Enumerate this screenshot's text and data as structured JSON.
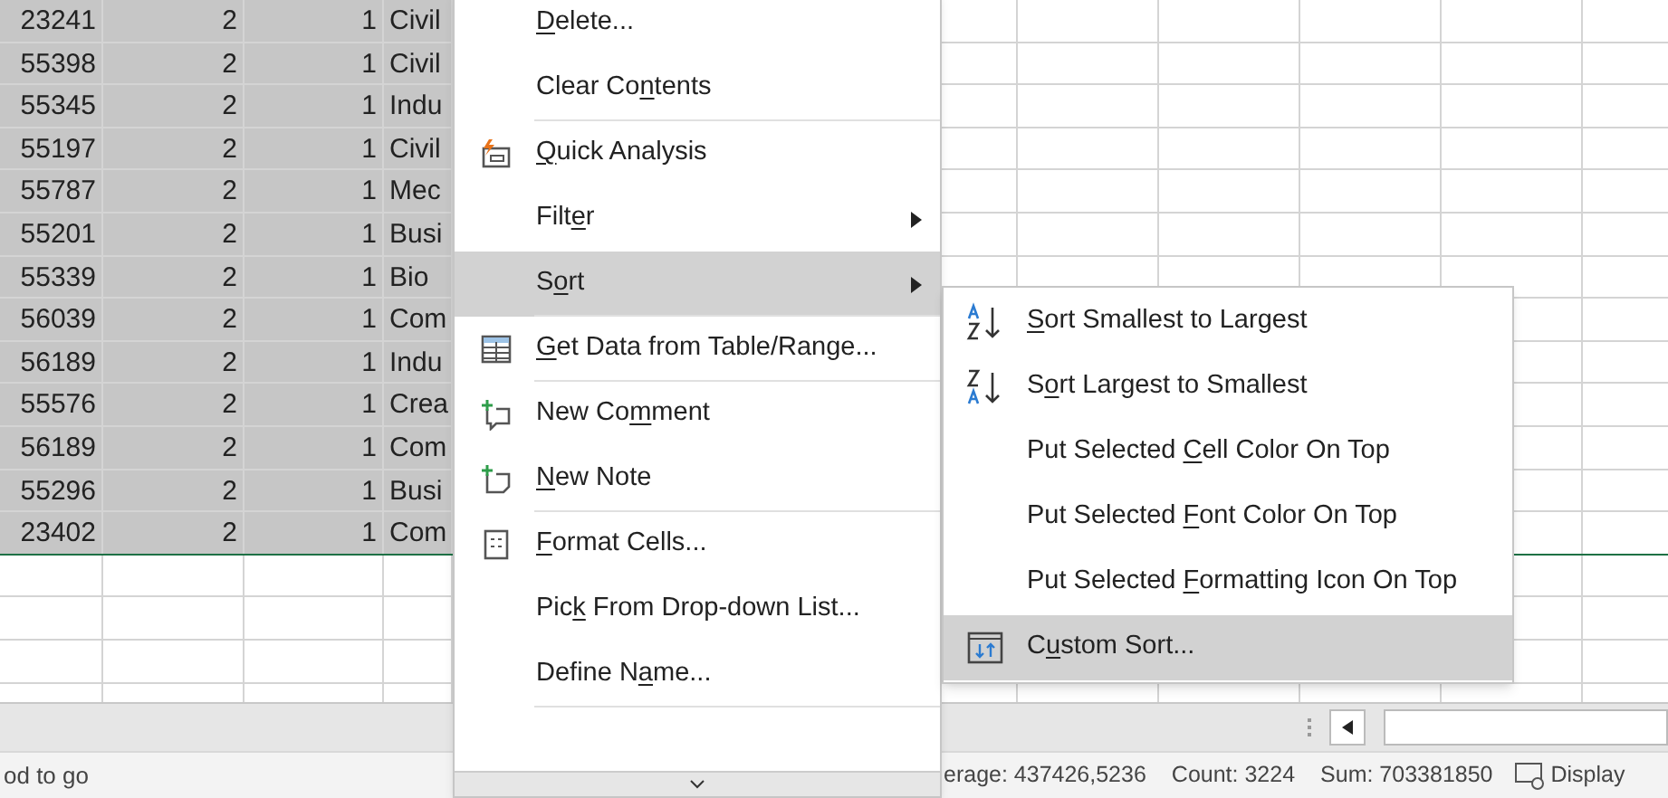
{
  "sheet": {
    "rows": [
      {
        "cells": [
          "23241",
          "2",
          "1",
          "Civil"
        ]
      },
      {
        "cells": [
          "55398",
          "2",
          "1",
          "Civil"
        ]
      },
      {
        "cells": [
          "55345",
          "2",
          "1",
          "Indu"
        ]
      },
      {
        "cells": [
          "55197",
          "2",
          "1",
          "Civil"
        ]
      },
      {
        "cells": [
          "55787",
          "2",
          "1",
          "Mec"
        ]
      },
      {
        "cells": [
          "55201",
          "2",
          "1",
          "Busi"
        ]
      },
      {
        "cells": [
          "55339",
          "2",
          "1",
          "Bio"
        ]
      },
      {
        "cells": [
          "56039",
          "2",
          "1",
          "Com"
        ]
      },
      {
        "cells": [
          "56189",
          "2",
          "1",
          "Indu"
        ]
      },
      {
        "cells": [
          "55576",
          "2",
          "1",
          "Crea"
        ]
      },
      {
        "cells": [
          "56189",
          "2",
          "1",
          "Com"
        ]
      },
      {
        "cells": [
          "55296",
          "2",
          "1",
          "Busi"
        ]
      },
      {
        "cells": [
          "23402",
          "2",
          "1",
          "Com"
        ]
      }
    ],
    "selected": true
  },
  "context_menu": {
    "items": [
      {
        "label": {
          "key": "D",
          "post": "elete..."
        },
        "selected": false,
        "submenu_arrow": false,
        "divider_after": false
      },
      {
        "label": {
          "pre": "Clear Co",
          "key": "n",
          "post": "tents"
        },
        "selected": false,
        "submenu_arrow": false,
        "divider_after": true
      },
      {
        "label": {
          "key": "Q",
          "post": "uick Analysis"
        },
        "selected": false,
        "submenu_arrow": false,
        "divider_after": false
      },
      {
        "label": {
          "pre": "Filt",
          "key": "e",
          "post": "r"
        },
        "selected": false,
        "submenu_arrow": true,
        "divider_after": false
      },
      {
        "label": {
          "pre": "S",
          "key": "o",
          "post": "rt"
        },
        "selected": true,
        "submenu_arrow": true,
        "divider_after": true
      },
      {
        "label": {
          "key": "G",
          "post": "et Data from Table/Range..."
        },
        "selected": false,
        "submenu_arrow": false,
        "divider_after": true
      },
      {
        "label": {
          "pre": "New Co",
          "key": "m",
          "post": "ment"
        },
        "selected": false,
        "submenu_arrow": false,
        "divider_after": false
      },
      {
        "label": {
          "key": "N",
          "post": "ew Note"
        },
        "selected": false,
        "submenu_arrow": false,
        "divider_after": true
      },
      {
        "label": {
          "key": "F",
          "post": "ormat Cells..."
        },
        "selected": false,
        "submenu_arrow": false,
        "divider_after": false
      },
      {
        "label": {
          "pre": "Pic",
          "key": "k",
          "post": " From Drop-down List..."
        },
        "selected": false,
        "submenu_arrow": false,
        "divider_after": false
      },
      {
        "label": {
          "pre": "Define N",
          "key": "a",
          "post": "me..."
        },
        "selected": false,
        "submenu_arrow": false,
        "divider_after": true
      }
    ]
  },
  "sort_submenu": {
    "items": [
      {
        "label": {
          "key": "S",
          "post": "ort Smallest to Largest"
        },
        "selected": false
      },
      {
        "label": {
          "pre": "S",
          "key": "o",
          "post": "rt Largest to Smallest"
        },
        "selected": false
      },
      {
        "label": {
          "pre": "Put Selected ",
          "key": "C",
          "post": "ell Color On Top"
        },
        "selected": false
      },
      {
        "label": {
          "pre": "Put Selected ",
          "key": "F",
          "post": "ont Color On Top"
        },
        "selected": false
      },
      {
        "label": {
          "pre": "Put Selected ",
          "key": "F",
          "post": "ormatting Icon On Top"
        },
        "selected": false
      },
      {
        "label": {
          "pre": "C",
          "key": "u",
          "post": "stom Sort..."
        },
        "selected": true
      }
    ]
  },
  "status_bar": {
    "ready": "od to go",
    "average": "erage: 437426,5236",
    "count": "Count: 3224",
    "sum": "Sum: 703381850",
    "display": "Display"
  }
}
